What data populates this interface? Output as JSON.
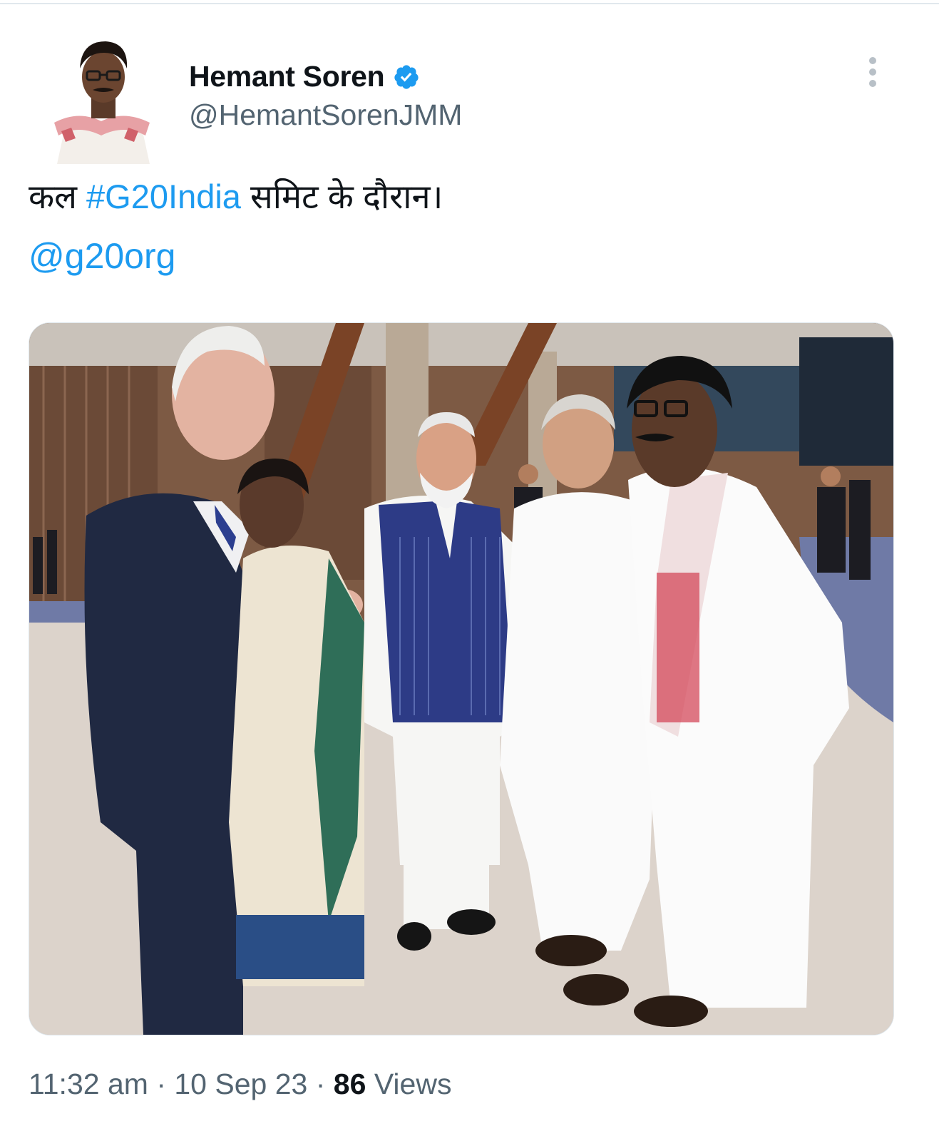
{
  "tweet": {
    "author": {
      "display_name": "Hemant Soren",
      "handle": "@HemantSorenJMM",
      "verified": true,
      "avatar_icon": "user-avatar"
    },
    "text_prefix": "कल ",
    "hashtag": "#G20India",
    "text_suffix": " समिट के दौरान।",
    "mention": "@g20org",
    "media": {
      "type": "photo"
    },
    "meta": {
      "time": "11:32 am",
      "separator": "·",
      "date": "10 Sep 23",
      "views_count": "86",
      "views_label": "Views"
    }
  },
  "colors": {
    "link": "#1d9bf0",
    "secondary_text": "#536471",
    "primary_text": "#0f1419",
    "verified_badge": "#1d9bf0"
  },
  "icons": {
    "verified": "verified-badge-icon",
    "more": "more-vertical-icon"
  }
}
